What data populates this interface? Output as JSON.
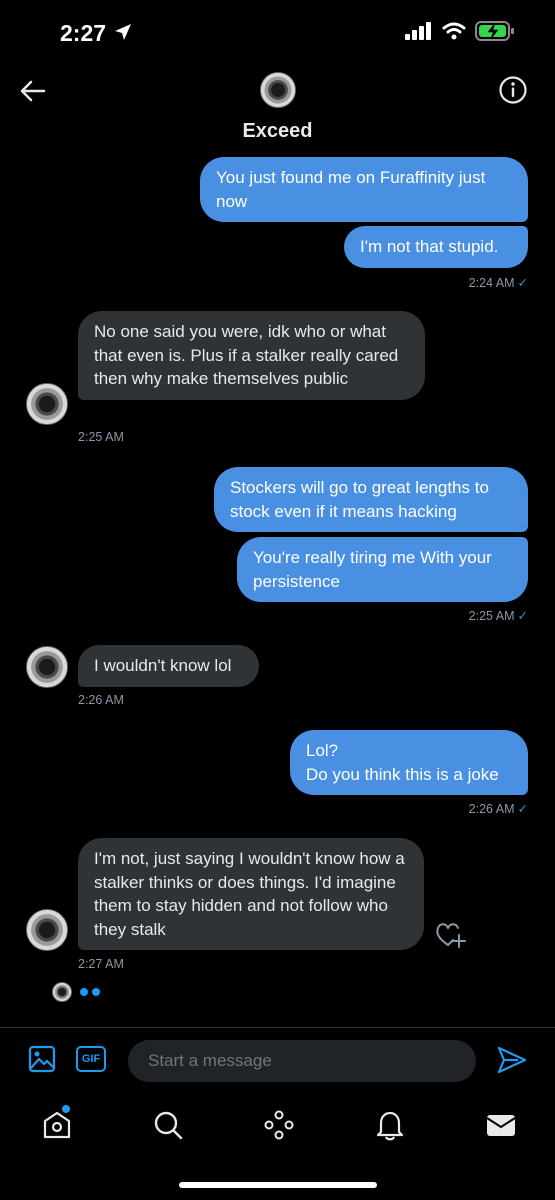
{
  "status_bar": {
    "time": "2:27"
  },
  "header": {
    "name": "Exceed"
  },
  "messages": [
    {
      "text": "You just found me on Furaffinity just now"
    },
    {
      "text": "I'm not that stupid."
    },
    {
      "text": "No one said you were, idk who or what that even is. Plus if a stalker really cared then why make themselves public"
    },
    {
      "text": "Stockers will go to great lengths to stock even if it means hacking"
    },
    {
      "text": "You're really tiring me With your persistence"
    },
    {
      "text": "I wouldn't know lol"
    },
    {
      "text": "Lol?\nDo you think this is a joke"
    },
    {
      "text": "I'm not, just saying I wouldn't know how a stalker thinks or does things. I'd imagine them to stay hidden and not follow who they stalk"
    }
  ],
  "timestamps": [
    "2:24 AM",
    "2:25 AM",
    "2:25 AM",
    "2:26 AM",
    "2:26 AM",
    "2:27 AM"
  ],
  "composer": {
    "placeholder": "Start a message",
    "gif_label": "GIF"
  },
  "colors": {
    "accent": "#1d9bf0",
    "outgoing_bubble": "#4a90e2",
    "incoming_bubble": "#2f3336",
    "background": "#000000"
  },
  "icons": {
    "back": "arrow-left-icon",
    "info": "info-icon",
    "media": "image-icon",
    "send": "send-icon",
    "tabs": [
      "home-icon",
      "search-icon",
      "spaces-icon",
      "bell-icon",
      "mail-icon"
    ],
    "react": "heart-plus-icon"
  }
}
